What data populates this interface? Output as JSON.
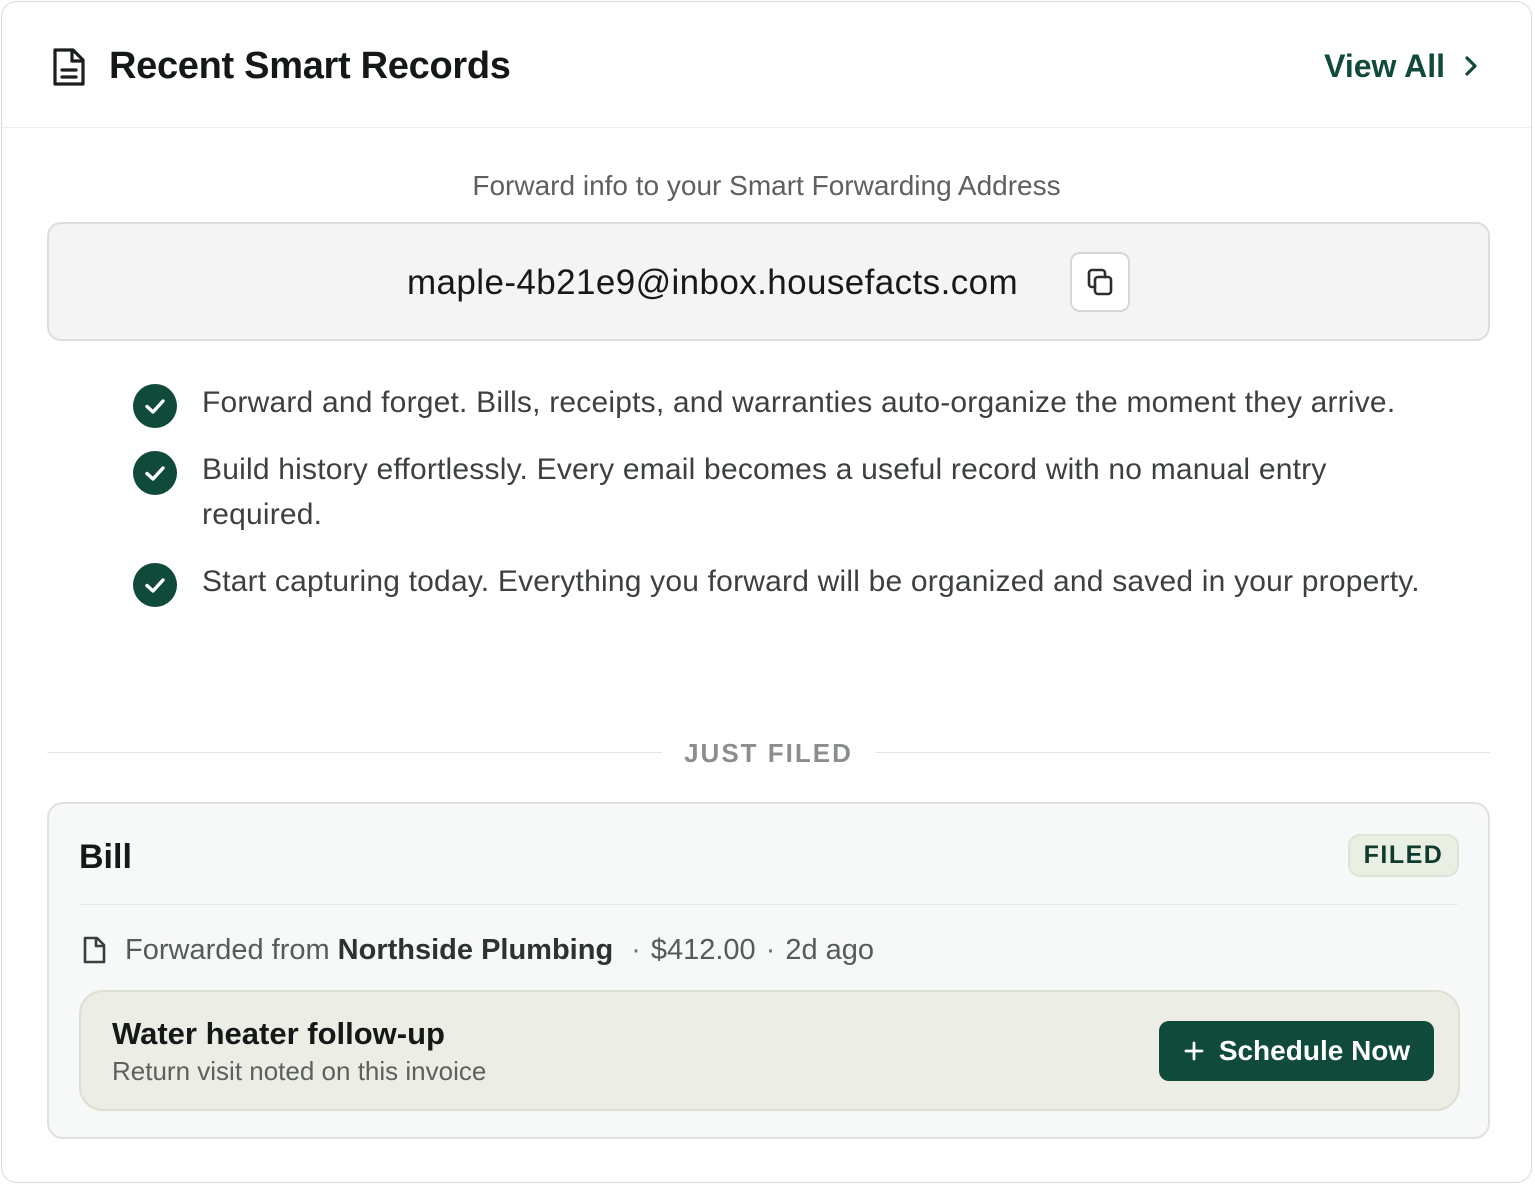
{
  "header": {
    "title": "Recent Smart Records",
    "icon": "document-icon",
    "view_all_label": "View All",
    "view_all_icon": "chevron-right-icon"
  },
  "forwarding": {
    "label": "Forward info to your Smart Forwarding Address",
    "address": "maple-4b21e9@inbox.housefacts.com",
    "copy_icon": "copy-icon"
  },
  "benefits": [
    {
      "text": "Forward and forget. Bills, receipts, and warranties auto-organize the moment they arrive."
    },
    {
      "text": "Build history effortlessly. Every email becomes a useful record with no manual entry required."
    },
    {
      "text": "Start capturing today. Everything you forward will be organized and saved in your property."
    }
  ],
  "section_label": "JUST FILED",
  "record": {
    "type": "Bill",
    "status": "FILED",
    "meta_prefix": "Forwarded from",
    "sender": "Northside Plumbing",
    "amount": "$412.00",
    "age": "2d ago",
    "separator": "·",
    "followup": {
      "title": "Water heater follow-up",
      "subtitle": "Return visit noted on this invoice",
      "button_label": "Schedule Now",
      "button_icon": "plus-icon"
    }
  },
  "colors": {
    "accent": "#0f4a3a",
    "badge_bg": "#eaefe4",
    "followup_bg": "#eceee5"
  }
}
